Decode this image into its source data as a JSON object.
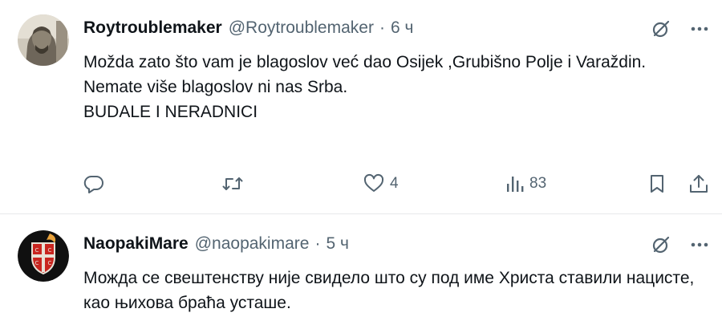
{
  "tweets": [
    {
      "author_name": "Roytroublemaker",
      "handle": "@Roytroublemaker",
      "separator": "·",
      "time": "6 ч",
      "lines": [
        "Možda zato što vam je blagoslov već dao Osijek ,Grubišno Polje i Varaždin.",
        "Nemate više blagoslov ni nas Srba.",
        "BUDALE I NERADNICI"
      ],
      "reply_count": "",
      "retweet_count": "",
      "like_count": "4",
      "view_count": "83"
    },
    {
      "author_name": "NaopakiMare",
      "handle": "@naopakimare",
      "separator": "·",
      "time": "5 ч",
      "lines": [
        "Можда се свештенству није свидело што су под име Христа ставили нацисте, као њихова браћа усташе."
      ]
    }
  ],
  "icons": {
    "grok": "grok-icon",
    "more": "more-icon",
    "reply": "reply-icon",
    "retweet": "retweet-icon",
    "like": "heart-icon",
    "views": "views-icon",
    "bookmark": "bookmark-icon",
    "share": "share-icon"
  },
  "colors": {
    "text": "#0f1419",
    "secondary": "#536471",
    "divider": "#e7e9ea"
  }
}
